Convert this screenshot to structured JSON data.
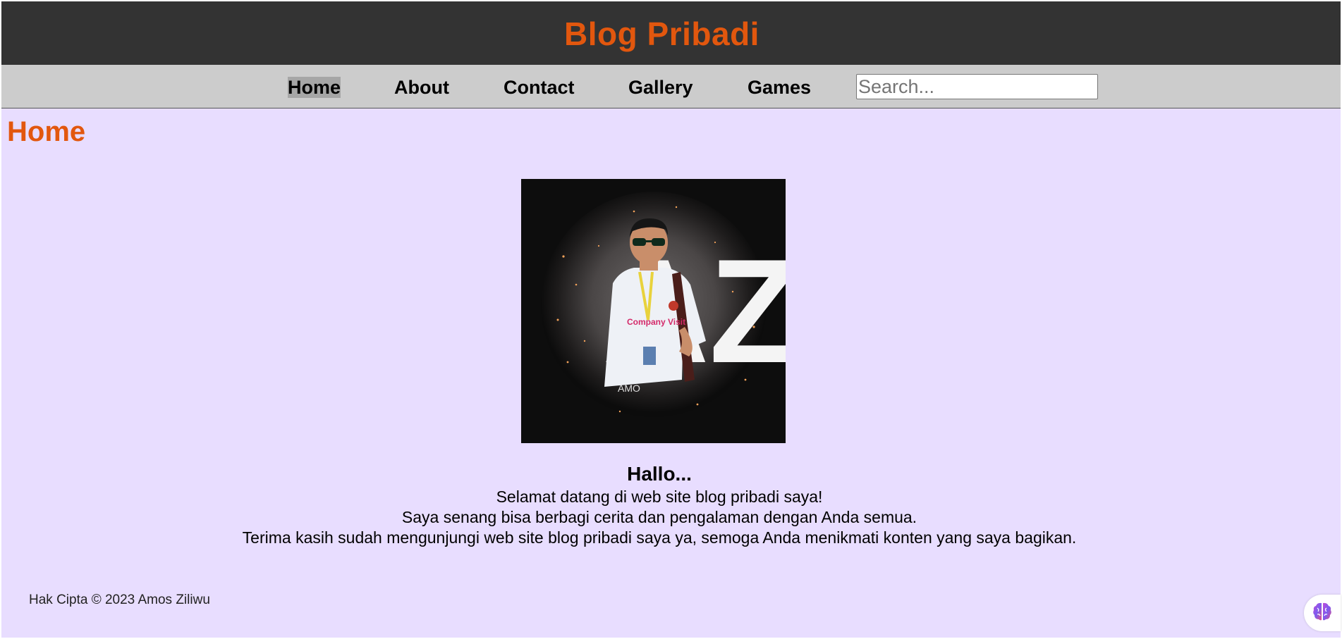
{
  "header": {
    "title": "Blog Pribadi"
  },
  "nav": {
    "items": [
      {
        "label": "Home",
        "active": true
      },
      {
        "label": "About",
        "active": false
      },
      {
        "label": "Contact",
        "active": false
      },
      {
        "label": "Gallery",
        "active": false
      },
      {
        "label": "Games",
        "active": false
      }
    ],
    "search_placeholder": "Search..."
  },
  "main": {
    "heading": "Home",
    "photo": {
      "icon": "profile-photo",
      "letters": "AZ",
      "caption": "AMO",
      "shirt_text": "Company Visit"
    },
    "greeting": "Hallo...",
    "intro_lines": [
      "Selamat datang di web site blog pribadi saya!",
      "Saya senang bisa berbagi cerita dan pengalaman dengan Anda semua.",
      "Terima kasih sudah mengunjungi web site blog pribadi saya ya, semoga Anda menikmati konten yang saya bagikan."
    ]
  },
  "footer": {
    "copyright": "Hak Cipta © 2023 Amos Ziliwu"
  },
  "assistant": {
    "icon": "brain-icon"
  },
  "colors": {
    "accent": "#e2570e",
    "header_bg": "#333333",
    "nav_bg": "#cccccc",
    "nav_active_bg": "#a6a6a6",
    "page_bg": "#e8ddff"
  }
}
